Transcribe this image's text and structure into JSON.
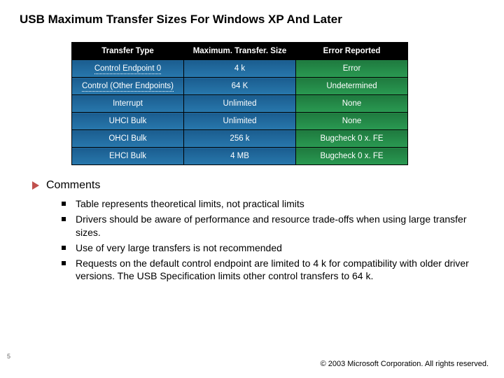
{
  "title": "USB Maximum Transfer Sizes For Windows XP And Later",
  "table": {
    "headers": [
      "Transfer Type",
      "Maximum. Transfer. Size",
      "Error Reported"
    ],
    "rows": [
      {
        "type": "Control Endpoint 0",
        "max": "4 k",
        "err": "Error",
        "dotted": true
      },
      {
        "type": "Control (Other Endpoints)",
        "max": "64 K",
        "err": "Undetermined",
        "dotted": true
      },
      {
        "type": "Interrupt",
        "max": "Unlimited",
        "err": "None",
        "dotted": false
      },
      {
        "type": "UHCI Bulk",
        "max": "Unlimited",
        "err": "None",
        "dotted": false
      },
      {
        "type": "OHCI Bulk",
        "max": "256 k",
        "err": "Bugcheck 0 x. FE",
        "dotted": false
      },
      {
        "type": "EHCI Bulk",
        "max": "4 MB",
        "err": "Bugcheck 0 x. FE",
        "dotted": false
      }
    ]
  },
  "comments_heading": "Comments",
  "comments": [
    "Table represents theoretical limits, not practical limits",
    "Drivers should be aware of performance and resource trade-offs when using large transfer sizes.",
    "Use of very large transfers is not recommended",
    "Requests on the default control endpoint are limited to 4 k for compatibility with older driver versions.  The USB Specification limits other control transfers to 64 k."
  ],
  "page_number": "5",
  "copyright": "© 2003 Microsoft Corporation. All rights reserved.",
  "chart_data": {
    "type": "table",
    "title": "USB Maximum Transfer Sizes For Windows XP And Later",
    "columns": [
      "Transfer Type",
      "Maximum Transfer Size",
      "Error Reported"
    ],
    "rows": [
      [
        "Control Endpoint 0",
        "4 k",
        "Error"
      ],
      [
        "Control (Other Endpoints)",
        "64 K",
        "Undetermined"
      ],
      [
        "Interrupt",
        "Unlimited",
        "None"
      ],
      [
        "UHCI Bulk",
        "Unlimited",
        "None"
      ],
      [
        "OHCI Bulk",
        "256 k",
        "Bugcheck 0xFE"
      ],
      [
        "EHCI Bulk",
        "4 MB",
        "Bugcheck 0xFE"
      ]
    ]
  }
}
